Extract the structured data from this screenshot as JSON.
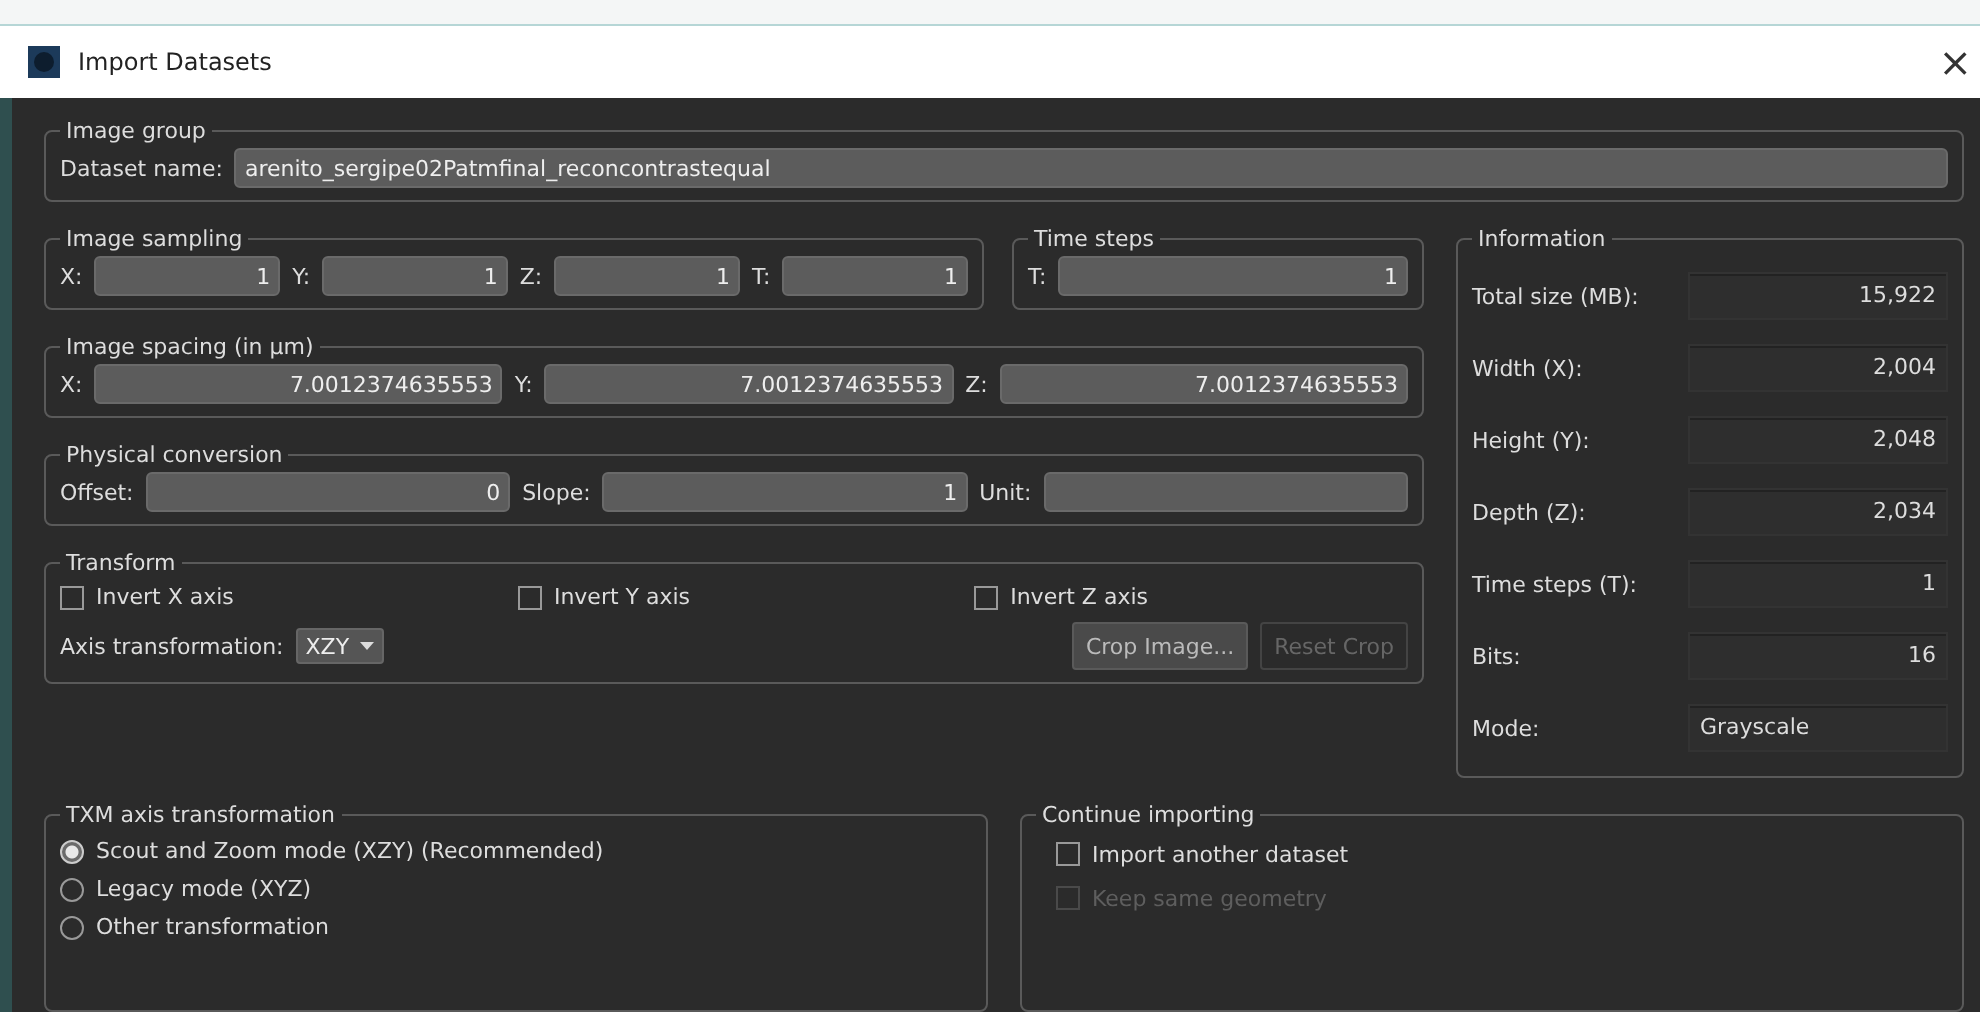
{
  "window": {
    "title": "Import Datasets",
    "close": "×"
  },
  "image_group": {
    "title": "Image group",
    "label": "Dataset name:",
    "value": "arenito_sergipe02Patmfinal_reconcontrastequal"
  },
  "image_sampling": {
    "title": "Image sampling",
    "fields": [
      {
        "label": "X:",
        "value": "1"
      },
      {
        "label": "Y:",
        "value": "1"
      },
      {
        "label": "Z:",
        "value": "1"
      },
      {
        "label": "T:",
        "value": "1"
      }
    ]
  },
  "time_steps": {
    "title": "Time steps",
    "fields": [
      {
        "label": "T:",
        "value": "1"
      }
    ]
  },
  "image_spacing": {
    "title": "Image spacing (in µm)",
    "fields": [
      {
        "label": "X:",
        "value": "7.0012374635553"
      },
      {
        "label": "Y:",
        "value": "7.0012374635553"
      },
      {
        "label": "Z:",
        "value": "7.0012374635553"
      }
    ]
  },
  "physical_conversion": {
    "title": "Physical conversion",
    "fields": [
      {
        "label": "Offset:",
        "value": "0"
      },
      {
        "label": "Slope:",
        "value": "1"
      },
      {
        "label": "Unit:"
      }
    ]
  },
  "transform": {
    "title": "Transform",
    "checkboxes": [
      {
        "label": "Invert X axis",
        "checked": false
      },
      {
        "label": "Invert Y axis",
        "checked": false
      },
      {
        "label": "Invert Z axis",
        "checked": false
      }
    ],
    "axis_label": "Axis transformation:",
    "axis_value": "XZY",
    "buttons": [
      {
        "label": "Crop Image...",
        "disabled": false
      },
      {
        "label": "Reset Crop",
        "disabled": true
      }
    ]
  },
  "information": {
    "title": "Information",
    "rows": [
      {
        "label": "Total size (MB):",
        "value": "15,922",
        "kind": "number"
      },
      {
        "label": "Width (X):",
        "value": "2,004",
        "kind": "number"
      },
      {
        "label": "Height (Y):",
        "value": "2,048",
        "kind": "number"
      },
      {
        "label": "Depth (Z):",
        "value": "2,034",
        "kind": "number"
      },
      {
        "label": "Time steps (T):",
        "value": "1",
        "kind": "number"
      },
      {
        "label": "Bits:",
        "value": "16",
        "kind": "number"
      },
      {
        "label": "Mode:",
        "value": "Grayscale",
        "kind": "text"
      }
    ]
  },
  "txm": {
    "title": "TXM axis transformation",
    "options": [
      {
        "label": "Scout and Zoom mode (XZY) (Recommended)",
        "selected": true
      },
      {
        "label": "Legacy mode (XYZ)",
        "selected": false
      },
      {
        "label": "Other transformation",
        "selected": false
      }
    ]
  },
  "continue_importing": {
    "title": "Continue importing",
    "checkboxes": [
      {
        "label": "Import another dataset",
        "checked": false,
        "disabled": false
      },
      {
        "label": "Keep same geometry",
        "checked": false,
        "disabled": true
      }
    ]
  }
}
